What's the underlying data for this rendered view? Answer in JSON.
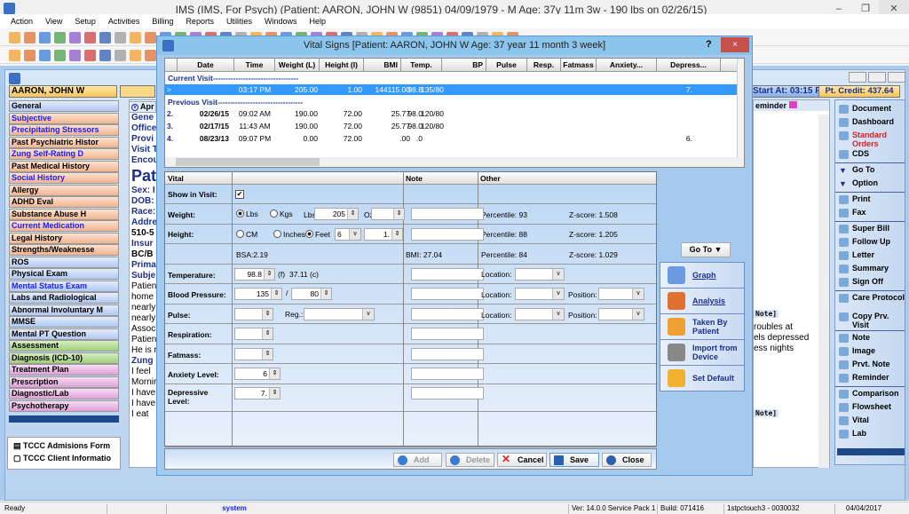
{
  "app": {
    "title": "IMS (IMS, For Psych)    (Patient: AARON, JOHN W (9851) 04/09/1979 - M Age: 37y 11m 3w - 190 lbs on 02/26/15)"
  },
  "menu": [
    "Action",
    "View",
    "Setup",
    "Activities",
    "Billing",
    "Reports",
    "Utilities",
    "Windows",
    "Help"
  ],
  "patient": {
    "name": "AARON, JOHN W",
    "start_at": "Start At: 03:15 P",
    "credit": "Pt. Credit: 437.64",
    "tab_partial": "Apr",
    "reminder": "eminder"
  },
  "sidebar": [
    {
      "label": "General",
      "c": "b",
      "blue": false
    },
    {
      "label": "Subjective",
      "c": "o",
      "blue": true
    },
    {
      "label": "Precipitating Stressors",
      "c": "o",
      "blue": true
    },
    {
      "label": "Past Psychiatric Histor",
      "c": "o",
      "blue": false
    },
    {
      "label": "Zung Self-Rating D",
      "c": "o",
      "blue": true
    },
    {
      "label": "Past Medical History",
      "c": "o",
      "blue": false
    },
    {
      "label": "Social History",
      "c": "o",
      "blue": true
    },
    {
      "label": "Allergy",
      "c": "o",
      "blue": false
    },
    {
      "label": "ADHD Eval",
      "c": "o",
      "blue": false
    },
    {
      "label": "Substance Abuse H",
      "c": "o",
      "blue": false
    },
    {
      "label": "Current Medication",
      "c": "o",
      "blue": true
    },
    {
      "label": "Legal History",
      "c": "o",
      "blue": false
    },
    {
      "label": "Strengths/Weaknesse",
      "c": "o",
      "blue": false
    },
    {
      "label": "ROS",
      "c": "b",
      "blue": false
    },
    {
      "label": "Physical Exam",
      "c": "b",
      "blue": false
    },
    {
      "label": "Mental Status Exam",
      "c": "b",
      "blue": true
    },
    {
      "label": "Labs and Radiological",
      "c": "b",
      "blue": false
    },
    {
      "label": "Abnormal Involuntary M",
      "c": "b",
      "blue": false
    },
    {
      "label": "MMSE",
      "c": "b",
      "blue": false
    },
    {
      "label": "Mental PT Question",
      "c": "b",
      "blue": false
    },
    {
      "label": "Assessment",
      "c": "g",
      "blue": false
    },
    {
      "label": "Diagnosis (ICD-10)",
      "c": "g",
      "blue": false
    },
    {
      "label": "Treatment Plan",
      "c": "p",
      "blue": false
    },
    {
      "label": "Prescription",
      "c": "p",
      "blue": false
    },
    {
      "label": "Diagnostic/Lab",
      "c": "p",
      "blue": false
    },
    {
      "label": "Psychotherapy",
      "c": "p",
      "blue": false
    }
  ],
  "forms": [
    "TCCC Admisions Form",
    "TCCC Client Informatio"
  ],
  "midpanel": [
    {
      "t": "Gene",
      "b": true
    },
    {
      "t": "Office",
      "b": true
    },
    {
      "t": "Provi",
      "b": true
    },
    {
      "t": "",
      "b": false
    },
    {
      "t": "Visit T",
      "b": true
    },
    {
      "t": "Encou",
      "b": true
    },
    {
      "t": "",
      "b": false
    },
    {
      "t": "Pat",
      "b": true,
      "big": true
    },
    {
      "t": "Sex: I",
      "b": true
    },
    {
      "t": "DOB:",
      "b": true
    },
    {
      "t": "Race:",
      "b": true
    },
    {
      "t": "Addre",
      "b": true
    },
    {
      "t": "510-5",
      "b": true,
      "black": true
    },
    {
      "t": "Insur",
      "b": true
    },
    {
      "t": "BC/B",
      "b": true,
      "black": true
    },
    {
      "t": "Prima",
      "b": true
    },
    {
      "t": "",
      "b": false
    },
    {
      "t": "Subje",
      "b": true
    },
    {
      "t": "Patien",
      "b": false
    },
    {
      "t": "home",
      "b": false
    },
    {
      "t": "nearly",
      "b": false
    },
    {
      "t": "nearly",
      "b": false
    },
    {
      "t": "Associ",
      "b": false
    },
    {
      "t": "Patien",
      "b": false
    },
    {
      "t": "He is r",
      "b": false
    },
    {
      "t": "",
      "b": false
    },
    {
      "t": "Zung",
      "b": true
    },
    {
      "t": "I feel",
      "b": false
    },
    {
      "t": "Mornir",
      "b": false
    },
    {
      "t": "I have",
      "b": false
    },
    {
      "t": "I have",
      "b": false
    },
    {
      "t": "I eat",
      "b": false
    }
  ],
  "rightpanel": {
    "note1": "Note]",
    "l1": "roubles at",
    "l2": "els depressed",
    "l3": "ess nights",
    "note2": "Note]"
  },
  "righttoolbar": [
    {
      "label": "Document",
      "red": false
    },
    {
      "label": "Dashboard",
      "red": false
    },
    {
      "label": "Standard Orders",
      "red": true
    },
    {
      "label": "CDS",
      "red": false
    },
    {
      "label": "Go To",
      "red": false
    },
    {
      "label": "Option",
      "red": false
    },
    {
      "label": "Print",
      "red": false
    },
    {
      "label": "Fax",
      "red": false
    },
    {
      "label": "Super Bill",
      "red": false
    },
    {
      "label": "Follow Up",
      "red": false
    },
    {
      "label": "Letter",
      "red": false
    },
    {
      "label": "Summary",
      "red": false
    },
    {
      "label": "Sign Off",
      "red": false
    },
    {
      "label": "Care Protocol",
      "red": false
    },
    {
      "label": "Copy Prv. Visit",
      "red": false
    },
    {
      "label": "Note",
      "red": false
    },
    {
      "label": "Image",
      "red": false
    },
    {
      "label": "Prvt. Note",
      "red": false
    },
    {
      "label": "Reminder",
      "red": false
    },
    {
      "label": "Comparison",
      "red": false
    },
    {
      "label": "Flowsheet",
      "red": false
    },
    {
      "label": "Vital",
      "red": false
    },
    {
      "label": "Lab",
      "red": false
    }
  ],
  "status": {
    "ready": "Ready",
    "user": "system",
    "version": "Ver: 14.0.0 Service Pack 1",
    "build": "Build: 071416",
    "machine": "1stpctouch3 - 0030032",
    "date": "04/04/2017"
  },
  "dialog": {
    "title": "Vital Signs  [Patient: AARON, JOHN W  Age: 37 year 11 month 3 week]",
    "help": "?",
    "close": "×",
    "columns": [
      "Date",
      "Time",
      "Weight (L)",
      "Height (I)",
      "BMI",
      "Temp.",
      "BP",
      "Pulse",
      "Resp.",
      "Fatmass",
      "Anxiety...",
      "Depress..."
    ],
    "current_label": "Current Visit----------------------------------",
    "previous_label": "Previous Visit----------------------------------",
    "current": {
      "marker": ">",
      "date": "",
      "time": "03:17 PM",
      "weight": "205.00",
      "height": "1.00",
      "bmi": "144115.00",
      "temp": "98.8",
      "bp": "135/80",
      "depress": "7."
    },
    "previous": [
      {
        "n": "2.",
        "date": "02/26/15",
        "time": "09:02 AM",
        "weight": "190.00",
        "height": "72.00",
        "bmi": "25.77",
        "temp": "98.0",
        "bp": "120/80",
        "depress": ""
      },
      {
        "n": "3.",
        "date": "02/17/15",
        "time": "11:43 AM",
        "weight": "190.00",
        "height": "72.00",
        "bmi": "25.77",
        "temp": "98.0",
        "bp": "120/80",
        "depress": ""
      },
      {
        "n": "4.",
        "date": "08/23/13",
        "time": "09:07 PM",
        "weight": "0.00",
        "height": "72.00",
        "bmi": ".00",
        "temp": ".0",
        "bp": "",
        "depress": "6."
      }
    ],
    "form": {
      "h_vital": "Vital",
      "h_note": "Note",
      "h_other": "Other",
      "show": "Show in Visit:",
      "weight": "Weight:",
      "lbs": "Lbs",
      "kgs": "Kgs",
      "lbs_label": "Lbs:",
      "weight_val": "205",
      "oz": "Oz:",
      "height": "Height:",
      "cm": "CM",
      "inches": "Inches",
      "feet": "Feet",
      "feet_val": "6",
      "inch_val": "1.",
      "bsa": "BSA:2.19",
      "bmi": "BMI: 27.04",
      "p1": "Percentile: 93",
      "z1": "Z-score: 1.508",
      "p2": "Percentile: 88",
      "z2": "Z-score: 1.205",
      "p3": "Percentile: 84",
      "z3": "Z-score: 1.029",
      "temp": "Temperature:",
      "temp_val": "98.8",
      "f": "(f)",
      "c": "37.11 (c)",
      "bp": "Blood Pressure:",
      "sys": "135",
      "slash": "/",
      "dia": "80",
      "pulse": "Pulse:",
      "reg": "Reg.:",
      "location": "Location:",
      "position": "Position:",
      "resp": "Respiration:",
      "fatmass": "Fatmass:",
      "anxiety": "Anxiety Level:",
      "anxiety_val": "6",
      "depressive": "Depressive Level:",
      "depressive_val": "7."
    },
    "goto": "Go To ▼",
    "side": [
      "Graph",
      "Analysis",
      "Taken By Patient",
      "Import from Device",
      "Set Default"
    ],
    "buttons": {
      "add": "Add",
      "delete": "Delete",
      "cancel": "Cancel",
      "save": "Save",
      "close": "Close"
    }
  }
}
